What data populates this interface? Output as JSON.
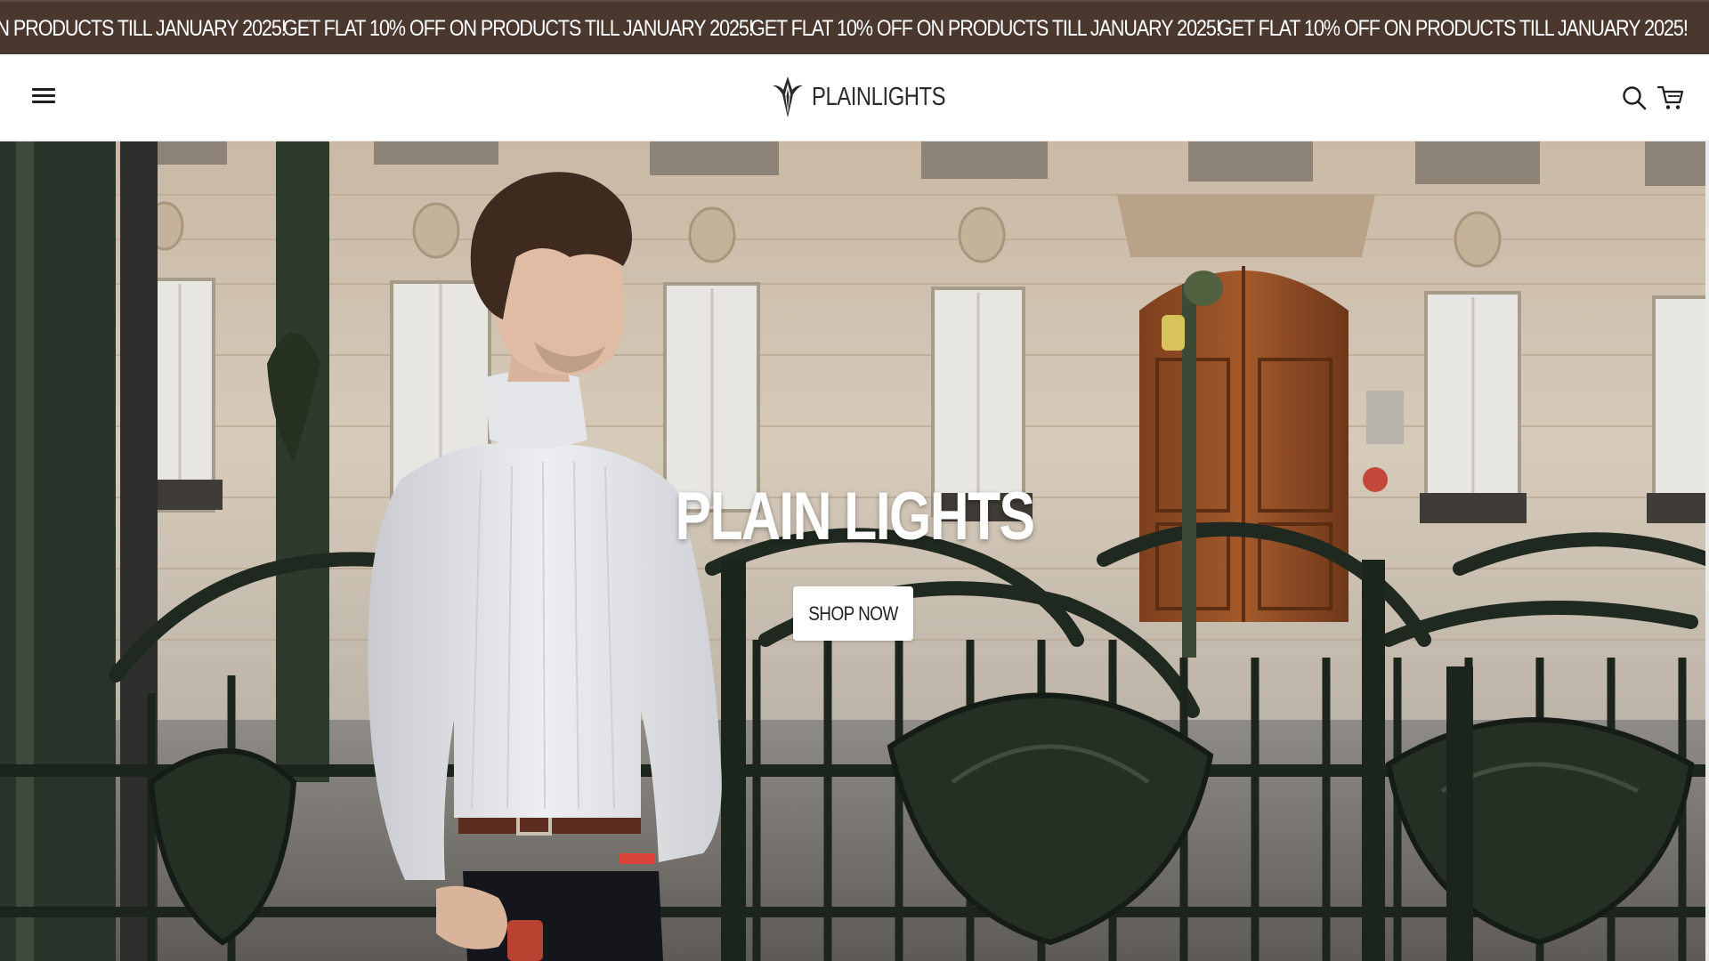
{
  "announcement": {
    "messages": [
      "GET FLAT 10% OFF ON PRODUCTS TILL JANUARY 2025!",
      "GET FLAT 10% OFF ON PRODUCTS TILL JANUARY 2025!",
      "GET FLAT 10% OFF ON PRODUCTS TILL JANUARY 2025!",
      "GET FLAT 10% OFF ON PRODUCTS TILL JANUARY 2025!"
    ],
    "background": "#4a382f",
    "text_color": "#ffffff"
  },
  "header": {
    "menu_icon": "hamburger-menu-icon",
    "logo_text": "PLAINLIGHTS",
    "search_icon": "search-icon",
    "cart_icon": "cart-icon"
  },
  "hero": {
    "title": "PLAIN LIGHTS",
    "cta_label": "SHOP NOW"
  }
}
